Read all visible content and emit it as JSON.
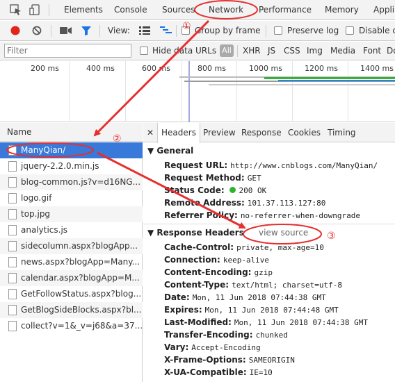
{
  "devtools": {
    "tabs": [
      "Elements",
      "Console",
      "Sources",
      "Network",
      "Performance",
      "Memory",
      "Appli"
    ],
    "active_tab": "Network"
  },
  "toolbar": {
    "view_label": "View:",
    "group_by_frame": "Group by frame",
    "preserve_log": "Preserve log",
    "disable_cache": "Disable c"
  },
  "filter": {
    "placeholder": "Filter",
    "hide_data_urls": "Hide data URLs",
    "all": "All",
    "types": [
      "XHR",
      "JS",
      "CSS",
      "Img",
      "Media",
      "Font",
      "Doc"
    ]
  },
  "timeline": {
    "ticks": [
      "200 ms",
      "400 ms",
      "600 ms",
      "800 ms",
      "1000 ms",
      "1200 ms",
      "1400 ms"
    ]
  },
  "request_list": {
    "header": "Name",
    "rows": [
      "ManyQian/",
      "jquery-2.2.0.min.js",
      "blog-common.js?v=d16NG...",
      "logo.gif",
      "top.jpg",
      "analytics.js",
      "sidecolumn.aspx?blogApp...",
      "news.aspx?blogApp=Many...",
      "calendar.aspx?blogApp=M...",
      "GetFollowStatus.aspx?blog...",
      "GetBlogSideBlocks.aspx?bl...",
      "collect?v=1&_v=j68&a=37..."
    ],
    "selected": "ManyQian/"
  },
  "details": {
    "close_glyph": "✕",
    "tabs": [
      "Headers",
      "Preview",
      "Response",
      "Cookies",
      "Timing"
    ],
    "active_tab": "Headers",
    "general_title": "General",
    "general": [
      {
        "k": "Request URL:",
        "v": "http://www.cnblogs.com/ManyQian/"
      },
      {
        "k": "Request Method:",
        "v": "GET"
      },
      {
        "k": "Status Code:",
        "v": "200 OK"
      },
      {
        "k": "Remote Address:",
        "v": "101.37.113.127:80"
      },
      {
        "k": "Referrer Policy:",
        "v": "no-referrer-when-downgrade"
      }
    ],
    "response_title": "Response Headers",
    "view_source": "view source",
    "response": [
      {
        "k": "Cache-Control:",
        "v": "private, max-age=10"
      },
      {
        "k": "Connection:",
        "v": "keep-alive"
      },
      {
        "k": "Content-Encoding:",
        "v": "gzip"
      },
      {
        "k": "Content-Type:",
        "v": "text/html; charset=utf-8"
      },
      {
        "k": "Date:",
        "v": "Mon, 11 Jun 2018 07:44:38 GMT"
      },
      {
        "k": "Expires:",
        "v": "Mon, 11 Jun 2018 07:44:48 GMT"
      },
      {
        "k": "Last-Modified:",
        "v": "Mon, 11 Jun 2018 07:44:38 GMT"
      },
      {
        "k": "Transfer-Encoding:",
        "v": "chunked"
      },
      {
        "k": "Vary:",
        "v": "Accept-Encoding"
      },
      {
        "k": "X-Frame-Options:",
        "v": "SAMEORIGIN"
      },
      {
        "k": "X-UA-Compatible:",
        "v": "IE=10"
      }
    ]
  },
  "annotations": [
    "①",
    "②",
    "③"
  ],
  "colors": {
    "annotation_red": "#e53030",
    "selected_blue": "#3879d9",
    "status_green": "#2db52d",
    "timeline_blue": "#1e88e5",
    "timeline_green": "#35b135"
  }
}
